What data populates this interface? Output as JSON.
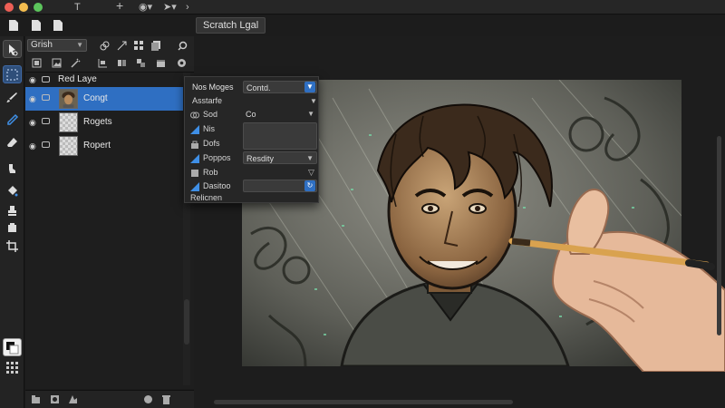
{
  "document_tab": {
    "label": "Scratch Lgal"
  },
  "tool_options": {
    "brush_preset": "Grish"
  },
  "layers": {
    "header_label": "Red Laye",
    "items": [
      {
        "name": "Congt",
        "selected": true,
        "thumb": "portrait"
      },
      {
        "name": "Rogets",
        "selected": false,
        "thumb": "transparent"
      },
      {
        "name": "Ropert",
        "selected": false,
        "thumb": "transparent"
      }
    ]
  },
  "properties_panel": {
    "title": "Nos Moges",
    "title_value": "Contd.",
    "rows": [
      {
        "label": "Asstarfe",
        "value": ""
      },
      {
        "label": "Sod",
        "value": "Co"
      },
      {
        "label": "Nis",
        "value": ""
      },
      {
        "label": "Dofs",
        "value": ""
      },
      {
        "label": "Poppos",
        "value": "Resdity"
      },
      {
        "label": "Rob",
        "value": ""
      },
      {
        "label": "Dasitoo",
        "value": ""
      },
      {
        "label": "Relicnen",
        "value": ""
      }
    ]
  },
  "icons": [
    "text-tool-icon",
    "add-icon",
    "fill-icon",
    "arrow-icon",
    "document-icon",
    "move-tool-icon",
    "marquee-tool-icon",
    "brush-tool-icon",
    "eraser-tool-icon",
    "smudge-tool-icon",
    "paint-bucket-icon",
    "transform-icon",
    "crop-icon",
    "eye-icon",
    "chain-link-icon",
    "new-layer-icon",
    "trash-icon"
  ],
  "colors": {
    "accent": "#2f6fc2",
    "panel_bg": "#262626",
    "app_bg": "#1a1a1a"
  }
}
